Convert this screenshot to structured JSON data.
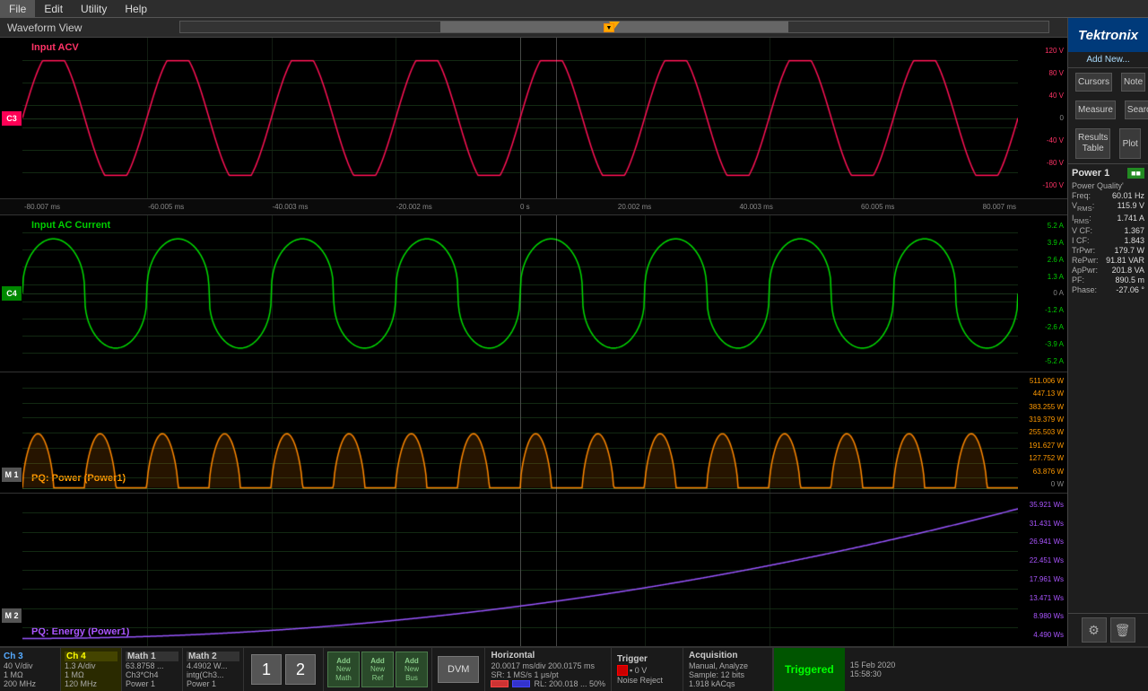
{
  "menubar": {
    "items": [
      "File",
      "Edit",
      "Utility",
      "Help"
    ]
  },
  "header": {
    "title": "Waveform View",
    "add_new": "Add New..."
  },
  "channels": {
    "ch3": {
      "label": "C3",
      "name": "Ch 3",
      "color": "#ff0055",
      "signal_label": "Input ACV"
    },
    "ch4": {
      "label": "C4",
      "name": "Ch 4",
      "color": "#00ff00",
      "signal_label": "Input AC Current"
    },
    "math1": {
      "label": "M 1",
      "name": "Math 1",
      "color": "#ff8800",
      "signal_label": "PQ: Power (Power1)"
    },
    "math2": {
      "label": "M 2",
      "name": "Math 2",
      "color": "#9955ff",
      "signal_label": "PQ: Energy (Power1)"
    }
  },
  "time_axis": {
    "ticks": [
      "-80.007 ms",
      "-60.005 ms",
      "-40.003 ms",
      "-20.002 ms",
      "0 s",
      "20.002 ms",
      "40.003 ms",
      "60.005 ms",
      "80.007 ms"
    ]
  },
  "y_axis_ch3": [
    "120 V",
    "80 V",
    "40 V",
    "0",
    "-40 V",
    "-80 V",
    "-100 V"
  ],
  "y_axis_ch4": [
    "5.2 A",
    "3.9 A",
    "2.6 A",
    "1.3 A",
    "0 A",
    "-1.2 A",
    "-2.6 A",
    "-3.9 A",
    "-5.2 A"
  ],
  "y_axis_math1": [
    "511.006 W",
    "447.13 W",
    "383.255 W",
    "319.379 W",
    "255.503 W",
    "191.627 W",
    "127.752 W",
    "63.876 W",
    "0 W"
  ],
  "y_axis_math2": [
    "35.921 Ws",
    "31.431 Ws",
    "26.941 Ws",
    "22.451 Ws",
    "17.961 Ws",
    "13.471 Ws",
    "8.980 Ws",
    "4.490 Ws"
  ],
  "right_panel": {
    "tektronix": "Tektronix",
    "cursors": "Cursors",
    "note": "Note",
    "measure": "Measure",
    "search": "Search",
    "results_table": "Results\nTable",
    "plot": "Plot"
  },
  "power1": {
    "title": "Power 1",
    "badge": "■",
    "badge_color": "#228b22",
    "metrics": [
      {
        "label": "Power Quality",
        "value": ""
      },
      {
        "label": "Freq:",
        "value": "60.01 Hz"
      },
      {
        "label": "VRMS:",
        "value": "115.9 V"
      },
      {
        "label": "IRMS:",
        "value": "1.741 A"
      },
      {
        "label": "V CF:",
        "value": "1.367"
      },
      {
        "label": "I CF:",
        "value": "1.843"
      },
      {
        "label": "TrPwr:",
        "value": "179.7 W"
      },
      {
        "label": "RePwr:",
        "value": "91.81 VAR"
      },
      {
        "label": "ApPwr:",
        "value": "201.8 VA"
      },
      {
        "label": "PF:",
        "value": "890.5 m"
      },
      {
        "label": "Phase:",
        "value": "-27.06 °"
      }
    ]
  },
  "bottom_bar": {
    "ch3": {
      "name": "Ch 3",
      "line1": "40 V/div",
      "line2": "1 MΩ",
      "line3": "200 MHz"
    },
    "ch4": {
      "name": "Ch 4",
      "line1": "1.3 A/div",
      "line2": "1 MΩ",
      "line3": "120 MHz"
    },
    "math1": {
      "name": "Math 1",
      "line1": "63.8758 ...",
      "line2": "Ch3*Ch4",
      "line3": "Power 1"
    },
    "math2": {
      "name": "Math 2",
      "line1": "4.4902 W...",
      "line2": "intg(Ch3...",
      "line3": "Power 1"
    },
    "nav": {
      "btn1": "1",
      "btn2": "2"
    },
    "add_new_math": "Add Ne\nMoth",
    "add_new_ref": "Add\nNew\nRef",
    "add_new_bus": "Add\nNew\nBus",
    "dvm": "DVM",
    "horizontal": {
      "title": "Horizontal",
      "line1": "20.0017 ms/div 200.0175 ms",
      "line2": "SR: 1 MS/s   1 μs/pt",
      "line3": "RL: 200.018 ...  50%"
    },
    "trigger": {
      "title": "Trigger",
      "value": "▪ 0 V",
      "sub": "Noise Reject"
    },
    "acquisition": {
      "title": "Acquisition",
      "line1": "Manual,   Analyze",
      "line2": "Sample: 12 bits",
      "line3": "1.918 kACqs"
    },
    "triggered": "Triggered",
    "date": "15 Feb 2020",
    "time": "15:58:30"
  }
}
